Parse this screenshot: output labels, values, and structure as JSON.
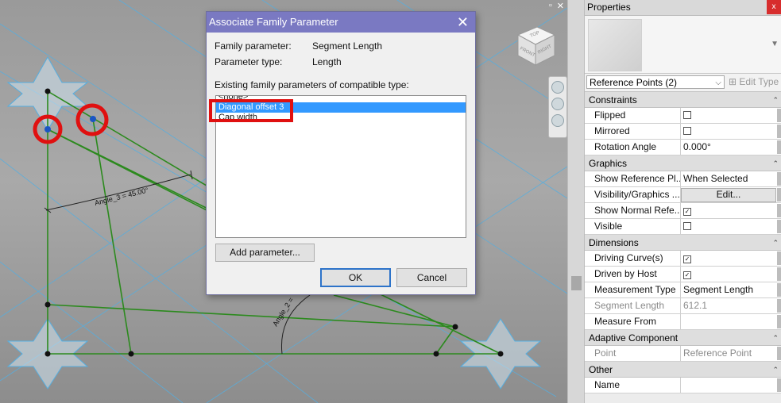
{
  "window_controls": [
    "▫",
    "✕"
  ],
  "viewcube": {
    "top": "TOP",
    "front": "FRONT",
    "right": "RIGHT"
  },
  "canvas": {
    "angle_label_1": "Angle_3 = 45.00°",
    "angle_label_2": "Angle_2 ="
  },
  "dialog": {
    "title": "Associate Family Parameter",
    "family_parameter_label": "Family parameter:",
    "family_parameter_value": "Segment Length",
    "parameter_type_label": "Parameter type:",
    "parameter_type_value": "Length",
    "list_caption": "Existing family parameters of compatible type:",
    "list_items": [
      {
        "label": "<none>",
        "selected": false
      },
      {
        "label": "Diagonal offset 3",
        "selected": true
      },
      {
        "label": "Cap width",
        "selected": false
      }
    ],
    "add_parameter_label": "Add parameter...",
    "ok_label": "OK",
    "cancel_label": "Cancel"
  },
  "properties": {
    "title": "Properties",
    "close_label": "x",
    "type_selector": "Reference Points (2)",
    "edit_type_label": "Edit Type",
    "groups": [
      {
        "name": "Constraints",
        "rows": [
          {
            "key": "Flipped",
            "value": "☐",
            "kind": "checkbox"
          },
          {
            "key": "Mirrored",
            "value": "☐",
            "kind": "checkbox"
          },
          {
            "key": "Rotation Angle",
            "value": "0.000°",
            "kind": "text"
          }
        ]
      },
      {
        "name": "Graphics",
        "rows": [
          {
            "key": "Show Reference Pl...",
            "value": "When Selected",
            "kind": "text"
          },
          {
            "key": "Visibility/Graphics ...",
            "value": "Edit...",
            "kind": "button"
          },
          {
            "key": "Show Normal Refe...",
            "value": "☑",
            "kind": "checkbox"
          },
          {
            "key": "Visible",
            "value": "☐",
            "kind": "checkbox"
          }
        ]
      },
      {
        "name": "Dimensions",
        "rows": [
          {
            "key": "Driving Curve(s)",
            "value": "☑",
            "kind": "checkbox"
          },
          {
            "key": "Driven by Host",
            "value": "☑",
            "kind": "checkbox"
          },
          {
            "key": "Measurement Type",
            "value": "Segment Length",
            "kind": "text"
          },
          {
            "key": "Segment Length",
            "value": "612.1",
            "kind": "readonly"
          },
          {
            "key": "Measure From",
            "value": "",
            "kind": "text"
          }
        ]
      },
      {
        "name": "Adaptive Component",
        "rows": [
          {
            "key": "Point",
            "value": "Reference Point",
            "kind": "readonly"
          }
        ]
      },
      {
        "name": "Other",
        "rows": [
          {
            "key": "Name",
            "value": "",
            "kind": "text"
          }
        ]
      }
    ]
  },
  "colors": {
    "dialog_title_bg": "#7a79c2",
    "selection": "#3399ff",
    "annotation_red": "#e01010",
    "geometry_green": "#2c8a1e",
    "grid_blue": "#4aa3d8"
  }
}
